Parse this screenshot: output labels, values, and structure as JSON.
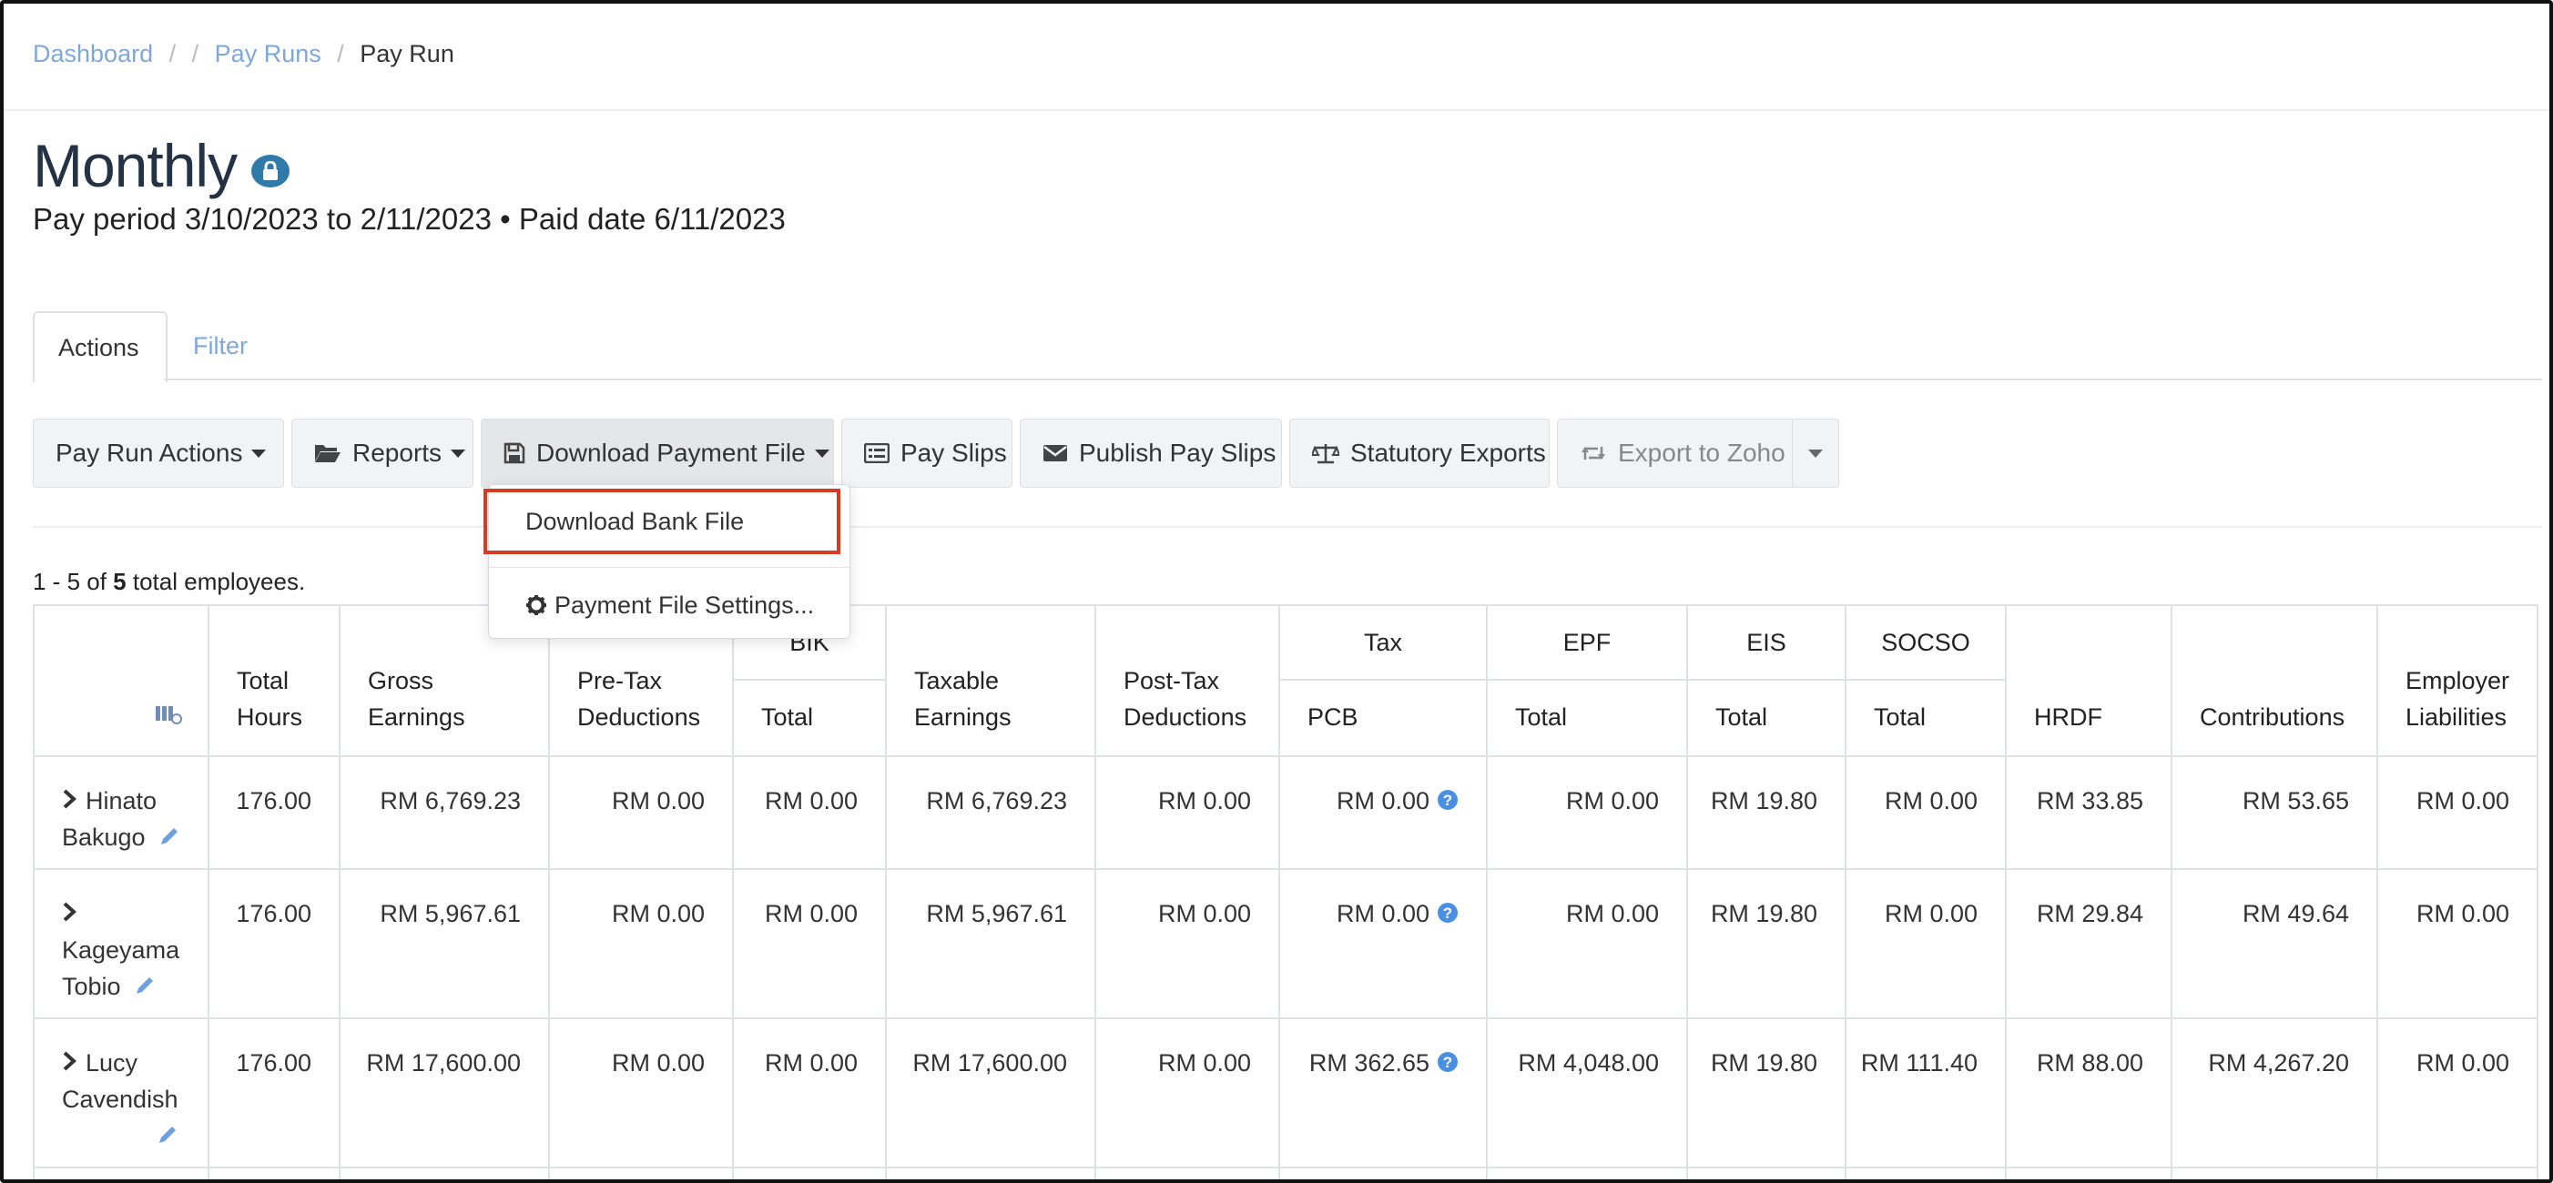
{
  "breadcrumb": {
    "dashboard": "Dashboard",
    "pay_runs": "Pay Runs",
    "current": "Pay Run"
  },
  "header": {
    "title": "Monthly",
    "subtitle": "Pay period 3/10/2023 to 2/11/2023 • Paid date 6/11/2023"
  },
  "tabs": {
    "actions": "Actions",
    "filter": "Filter"
  },
  "toolbar": {
    "pay_run_actions": "Pay Run Actions",
    "reports": "Reports",
    "download_payment_file": "Download Payment File",
    "pay_slips": "Pay Slips",
    "publish_pay_slips": "Publish Pay Slips",
    "statutory_exports": "Statutory Exports",
    "export_to_zoho": "Export to Zoho"
  },
  "dropdown": {
    "download_bank_file": "Download Bank File",
    "payment_file_settings": "Payment File Settings..."
  },
  "summary": {
    "prefix": "1 - 5 of",
    "count": "5",
    "suffix": "total employees."
  },
  "table": {
    "groups": {
      "bik": "BIK",
      "tax": "Tax",
      "epf": "EPF",
      "eis": "EIS",
      "socso": "SOCSO"
    },
    "headers": {
      "total_hours": "Total Hours",
      "gross_earnings": "Gross Earnings",
      "pre_tax_deductions": "Pre-Tax Deductions",
      "bik_total": "Total",
      "taxable_earnings": "Taxable Earnings",
      "post_tax_deductions": "Post-Tax Deductions",
      "pcb": "PCB",
      "epf_total": "Total",
      "eis_total": "Total",
      "socso_total": "Total",
      "hrdf": "HRDF",
      "contributions": "Contributions",
      "employer_liabilities": "Employer Liabilities"
    },
    "rows": [
      {
        "name": "Hinato Bakugo",
        "hours": "176.00",
        "gross": "RM 6,769.23",
        "pretax": "RM 0.00",
        "bik": "RM 0.00",
        "taxable": "RM 6,769.23",
        "posttax": "RM 0.00",
        "pcb": "RM 0.00",
        "epf": "RM 0.00",
        "eis": "RM 19.80",
        "socso": "RM 0.00",
        "hrdf": "RM 33.85",
        "contrib": "RM 53.65",
        "liab": "RM 0.00"
      },
      {
        "name": "Kageyama Tobio",
        "hours": "176.00",
        "gross": "RM 5,967.61",
        "pretax": "RM 0.00",
        "bik": "RM 0.00",
        "taxable": "RM 5,967.61",
        "posttax": "RM 0.00",
        "pcb": "RM 0.00",
        "epf": "RM 0.00",
        "eis": "RM 19.80",
        "socso": "RM 0.00",
        "hrdf": "RM 29.84",
        "contrib": "RM 49.64",
        "liab": "RM 0.00"
      },
      {
        "name": "Lucy Cavendish",
        "hours": "176.00",
        "gross": "RM 17,600.00",
        "pretax": "RM 0.00",
        "bik": "RM 0.00",
        "taxable": "RM 17,600.00",
        "posttax": "RM 0.00",
        "pcb": "RM 362.65",
        "epf": "RM 4,048.00",
        "eis": "RM 19.80",
        "socso": "RM 111.40",
        "hrdf": "RM 88.00",
        "contrib": "RM 4,267.20",
        "liab": "RM 0.00"
      }
    ]
  },
  "colors": {
    "link": "#7fa8d8",
    "title": "#233345",
    "lock_badge": "#2f7aa8",
    "highlight": "#d63b23",
    "help_icon": "#4a90e2"
  }
}
